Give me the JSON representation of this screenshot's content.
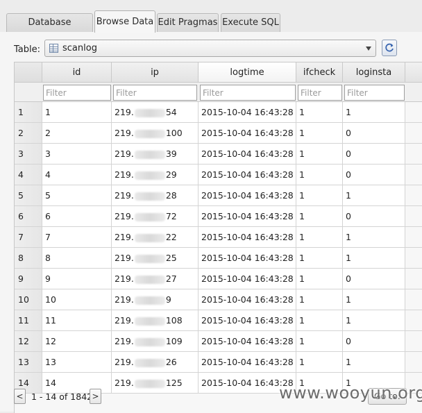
{
  "tabs": [
    {
      "label": "Database Structure"
    },
    {
      "label": "Browse Data"
    },
    {
      "label": "Edit Pragmas"
    },
    {
      "label": "Execute SQL"
    }
  ],
  "active_tab": "Browse Data",
  "table_selector": {
    "label": "Table:",
    "value": "scanlog",
    "icon": "table-icon"
  },
  "refresh_icon": "refresh-icon",
  "grid": {
    "columns": [
      "id",
      "ip",
      "logtime",
      "ifcheck",
      "loginsta"
    ],
    "filter_placeholder": "Filter",
    "rows": [
      {
        "n": "1",
        "id": "1",
        "ip_prefix": "219.",
        "ip_suffix": "54",
        "logtime": "2015-10-04 16:43:28",
        "ifcheck": "1",
        "loginsta": "1"
      },
      {
        "n": "2",
        "id": "2",
        "ip_prefix": "219.",
        "ip_suffix": "100",
        "logtime": "2015-10-04 16:43:28",
        "ifcheck": "1",
        "loginsta": "0"
      },
      {
        "n": "3",
        "id": "3",
        "ip_prefix": "219.",
        "ip_suffix": "39",
        "logtime": "2015-10-04 16:43:28",
        "ifcheck": "1",
        "loginsta": "0"
      },
      {
        "n": "4",
        "id": "4",
        "ip_prefix": "219.",
        "ip_suffix": "29",
        "logtime": "2015-10-04 16:43:28",
        "ifcheck": "1",
        "loginsta": "0"
      },
      {
        "n": "5",
        "id": "5",
        "ip_prefix": "219.",
        "ip_suffix": "28",
        "logtime": "2015-10-04 16:43:28",
        "ifcheck": "1",
        "loginsta": "1"
      },
      {
        "n": "6",
        "id": "6",
        "ip_prefix": "219.",
        "ip_suffix": "72",
        "logtime": "2015-10-04 16:43:28",
        "ifcheck": "1",
        "loginsta": "0"
      },
      {
        "n": "7",
        "id": "7",
        "ip_prefix": "219.",
        "ip_suffix": "22",
        "logtime": "2015-10-04 16:43:28",
        "ifcheck": "1",
        "loginsta": "1"
      },
      {
        "n": "8",
        "id": "8",
        "ip_prefix": "219.",
        "ip_suffix": "25",
        "logtime": "2015-10-04 16:43:28",
        "ifcheck": "1",
        "loginsta": "1"
      },
      {
        "n": "9",
        "id": "9",
        "ip_prefix": "219.",
        "ip_suffix": "27",
        "logtime": "2015-10-04 16:43:28",
        "ifcheck": "1",
        "loginsta": "0"
      },
      {
        "n": "10",
        "id": "10",
        "ip_prefix": "219.",
        "ip_suffix": "9",
        "logtime": "2015-10-04 16:43:28",
        "ifcheck": "1",
        "loginsta": "1"
      },
      {
        "n": "11",
        "id": "11",
        "ip_prefix": "219.",
        "ip_suffix": "108",
        "logtime": "2015-10-04 16:43:28",
        "ifcheck": "1",
        "loginsta": "1"
      },
      {
        "n": "12",
        "id": "12",
        "ip_prefix": "219.",
        "ip_suffix": "109",
        "logtime": "2015-10-04 16:43:28",
        "ifcheck": "1",
        "loginsta": "0"
      },
      {
        "n": "13",
        "id": "13",
        "ip_prefix": "219.",
        "ip_suffix": "26",
        "logtime": "2015-10-04 16:43:28",
        "ifcheck": "1",
        "loginsta": "1"
      },
      {
        "n": "14",
        "id": "14",
        "ip_prefix": "219.",
        "ip_suffix": "125",
        "logtime": "2015-10-04 16:43:28",
        "ifcheck": "1",
        "loginsta": "1"
      }
    ]
  },
  "pager": {
    "prev": "<",
    "range_text": "1 - 14 of 1842",
    "next": ">",
    "goto": "Go to:"
  },
  "watermark": "www.wooyun.org"
}
